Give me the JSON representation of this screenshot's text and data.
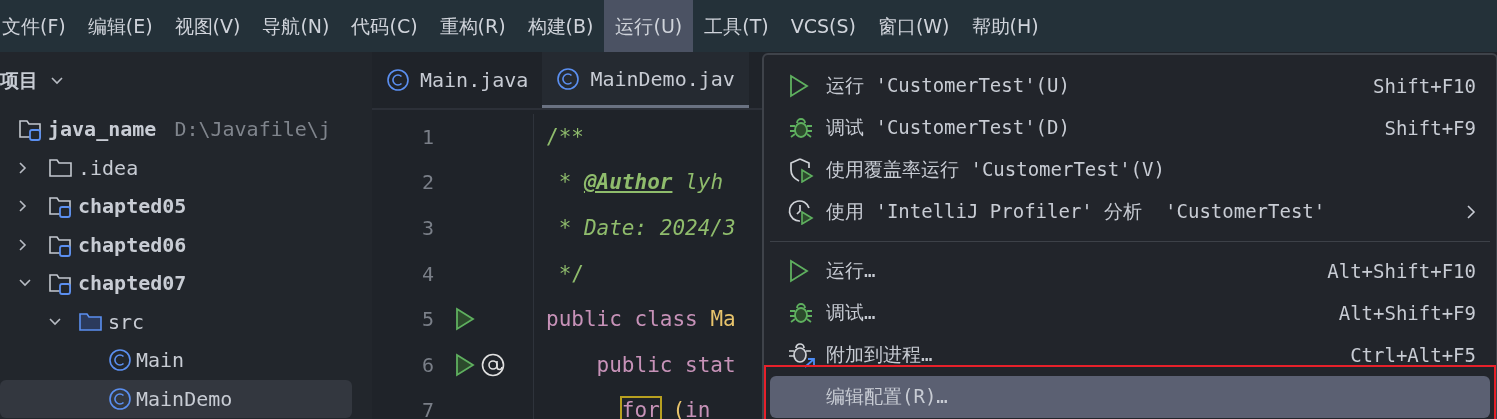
{
  "menubar": [
    {
      "label": "文件(F)",
      "selected": false
    },
    {
      "label": "编辑(E)",
      "selected": false
    },
    {
      "label": "视图(V)",
      "selected": false
    },
    {
      "label": "导航(N)",
      "selected": false
    },
    {
      "label": "代码(C)",
      "selected": false
    },
    {
      "label": "重构(R)",
      "selected": false
    },
    {
      "label": "构建(B)",
      "selected": false
    },
    {
      "label": "运行(U)",
      "selected": true
    },
    {
      "label": "工具(T)",
      "selected": false
    },
    {
      "label": "VCS(S)",
      "selected": false
    },
    {
      "label": "窗口(W)",
      "selected": false
    },
    {
      "label": "帮助(H)",
      "selected": false
    }
  ],
  "sidebar": {
    "title": "项目",
    "tree": [
      {
        "label": "java_name",
        "kind": "module",
        "hint": "D:\\Javafile\\j",
        "selected": false,
        "children": [
          {
            "label": ".idea",
            "kind": "folder",
            "expanded": false,
            "selected": false
          },
          {
            "label": "chapted05",
            "kind": "module",
            "expanded": false,
            "selected": false
          },
          {
            "label": "chapted06",
            "kind": "module",
            "expanded": false,
            "selected": false
          },
          {
            "label": "chapted07",
            "kind": "module",
            "expanded": true,
            "selected": false,
            "children": [
              {
                "label": "src",
                "kind": "source",
                "expanded": true,
                "selected": false,
                "children": [
                  {
                    "label": "Main",
                    "kind": "class",
                    "selected": false
                  },
                  {
                    "label": "MainDemo",
                    "kind": "class",
                    "selected": true
                  }
                ]
              }
            ]
          }
        ]
      }
    ]
  },
  "tabs": [
    {
      "label": "Main.java",
      "selected": false
    },
    {
      "label": "MainDemo.jav",
      "selected": true
    }
  ],
  "editor": {
    "lines": [
      {
        "number": "1",
        "kind": "comment",
        "tokens": [
          {
            "text": "/**",
            "kind": "doc"
          }
        ]
      },
      {
        "number": "2",
        "kind": "comment",
        "tokens": [
          {
            "text": " * ",
            "kind": "doc-italic"
          },
          {
            "text": "@Author",
            "kind": "doc-tag"
          },
          {
            "text": " lyh",
            "kind": "doc-italic"
          }
        ]
      },
      {
        "number": "3",
        "kind": "comment",
        "tokens": [
          {
            "text": " * Date: 2024/3",
            "kind": "doc-italic"
          }
        ]
      },
      {
        "number": "4",
        "kind": "comment",
        "tokens": [
          {
            "text": " */",
            "kind": "doc"
          }
        ]
      },
      {
        "number": "5",
        "kind": "class-declaration",
        "tokens": [
          {
            "text": "public class ",
            "kind": "keyword"
          },
          {
            "text": "Ma",
            "kind": "classname"
          }
        ]
      },
      {
        "number": "6",
        "kind": "method-declaration",
        "tokens": [
          {
            "text": "    public stat",
            "kind": "keyword"
          }
        ]
      },
      {
        "number": "7",
        "kind": "nested-statement",
        "tokens": [
          {
            "text": "for",
            "kind": "keyword-match"
          },
          {
            "text": " (",
            "kind": "paren"
          },
          {
            "text": "in",
            "kind": "keyword"
          }
        ]
      }
    ]
  },
  "run_menu": {
    "groups": [
      [
        {
          "label": "运行 'CustomerTest'(U)",
          "shortcut": "Shift+F10",
          "kind": "run",
          "submenu": false,
          "selected": false,
          "annotated": false
        },
        {
          "label": "调试 'CustomerTest'(D)",
          "shortcut": "Shift+F9",
          "kind": "debug",
          "submenu": false,
          "selected": false,
          "annotated": false
        },
        {
          "label": "使用覆盖率运行 'CustomerTest'(V)",
          "kind": "coverage",
          "submenu": false,
          "selected": false,
          "annotated": false
        },
        {
          "label": "使用 'IntelliJ Profiler' 分析  'CustomerTest'",
          "kind": "profiler",
          "submenu": true,
          "selected": false,
          "annotated": false
        }
      ],
      [
        {
          "label": "运行…",
          "shortcut": "Alt+Shift+F10",
          "kind": "run",
          "submenu": false,
          "selected": false,
          "annotated": false
        },
        {
          "label": "调试…",
          "shortcut": "Alt+Shift+F9",
          "kind": "debug",
          "submenu": false,
          "selected": false,
          "annotated": false
        },
        {
          "label": "附加到进程…",
          "shortcut": "Ctrl+Alt+F5",
          "kind": "attach",
          "submenu": false,
          "selected": false,
          "annotated": false
        },
        {
          "label": "编辑配置(R)…",
          "kind": "configure",
          "submenu": false,
          "selected": true,
          "annotated": true
        }
      ]
    ]
  }
}
